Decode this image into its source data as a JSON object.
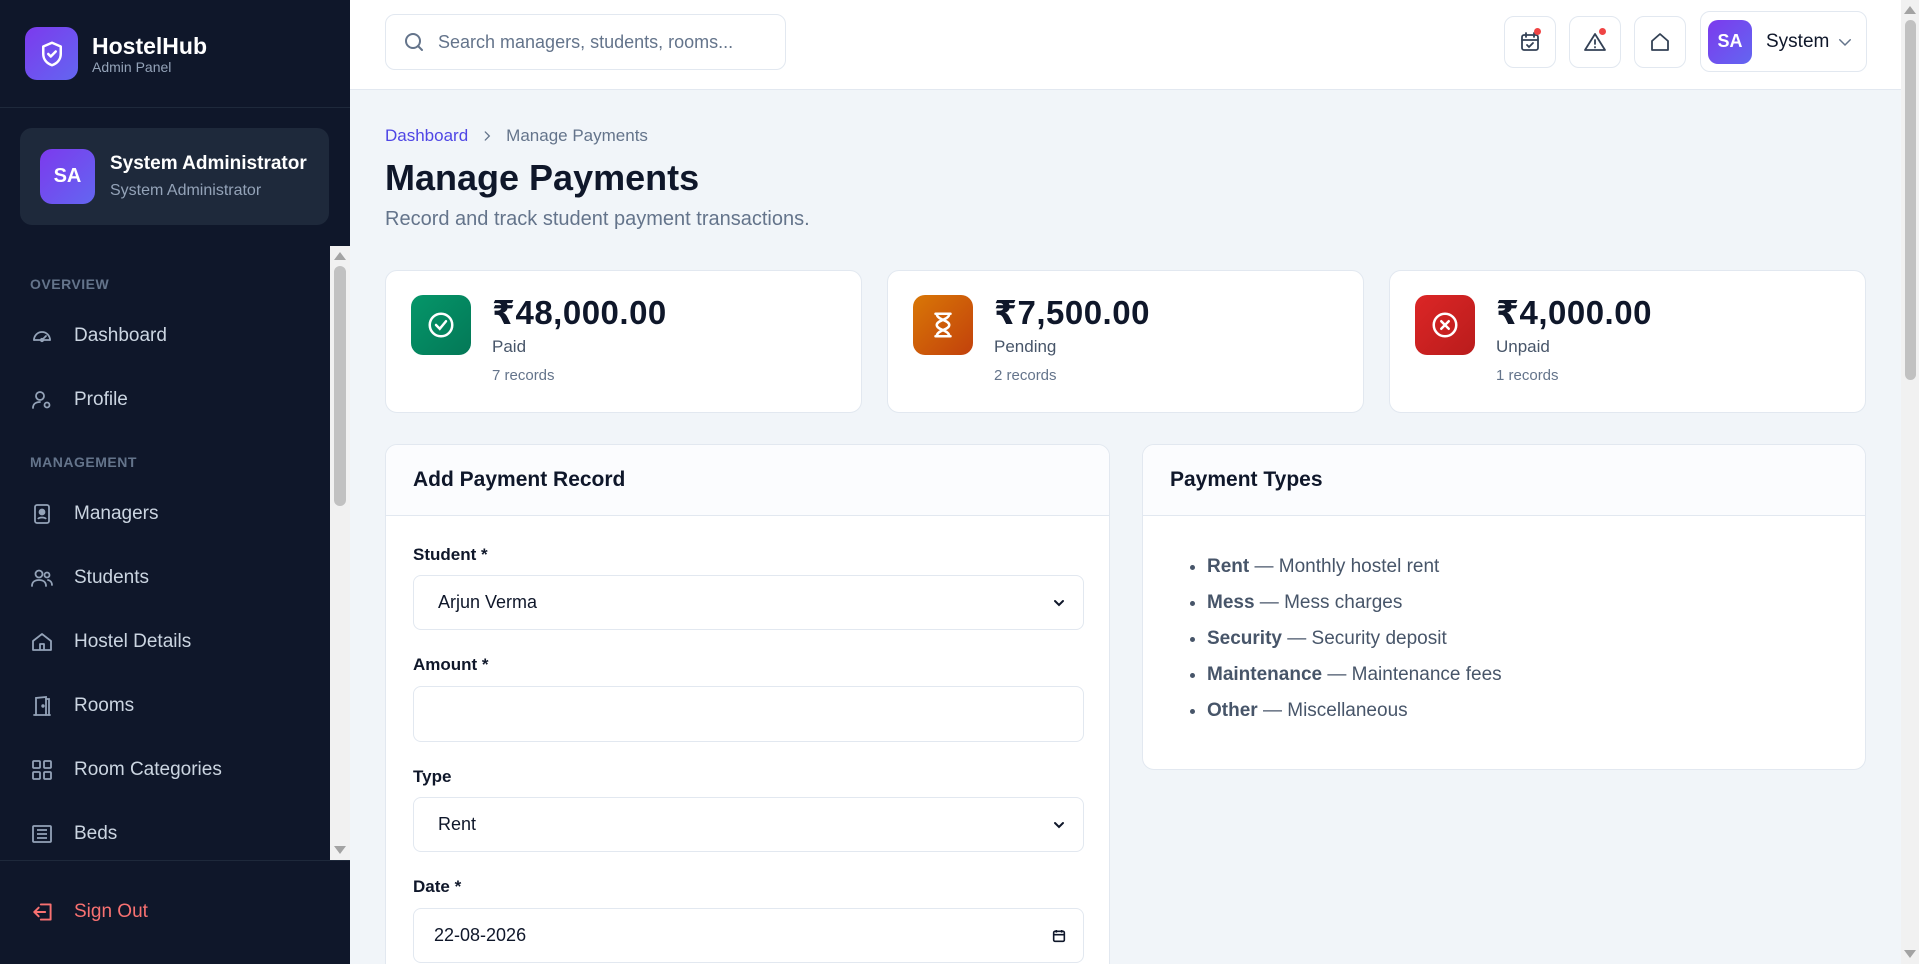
{
  "brand": {
    "name": "HostelHub",
    "subtitle": "Admin Panel"
  },
  "user": {
    "initials": "SA",
    "name": "System Administrator",
    "role": "System Administrator",
    "short_name": "System"
  },
  "sidebar": {
    "sections": [
      {
        "title": "OVERVIEW",
        "items": [
          {
            "label": "Dashboard",
            "icon": "gauge-icon"
          },
          {
            "label": "Profile",
            "icon": "user-gear-icon"
          }
        ]
      },
      {
        "title": "MANAGEMENT",
        "items": [
          {
            "label": "Managers",
            "icon": "id-badge-icon"
          },
          {
            "label": "Students",
            "icon": "users-icon"
          },
          {
            "label": "Hostel Details",
            "icon": "home-icon"
          },
          {
            "label": "Rooms",
            "icon": "door-icon"
          },
          {
            "label": "Room Categories",
            "icon": "grid-icon"
          },
          {
            "label": "Beds",
            "icon": "bed-icon"
          }
        ]
      }
    ],
    "sign_out": "Sign Out"
  },
  "header": {
    "search_placeholder": "Search managers, students, rooms..."
  },
  "breadcrumb": {
    "root": "Dashboard",
    "current": "Manage Payments"
  },
  "page": {
    "title": "Manage Payments",
    "subtitle": "Record and track student payment transactions."
  },
  "stats": [
    {
      "value": "₹48,000.00",
      "label": "Paid",
      "count": "7 records",
      "color": "#059669"
    },
    {
      "value": "₹7,500.00",
      "label": "Pending",
      "count": "2 records",
      "color": "#d97706"
    },
    {
      "value": "₹4,000.00",
      "label": "Unpaid",
      "count": "1 records",
      "color": "#dc2626"
    }
  ],
  "form": {
    "title": "Add Payment Record",
    "student_label": "Student *",
    "student_value": "Arjun Verma",
    "amount_label": "Amount *",
    "amount_value": "",
    "type_label": "Type",
    "type_value": "Rent",
    "date_label": "Date *",
    "date_value": "22-08-2026"
  },
  "payment_types": {
    "title": "Payment Types",
    "items": [
      {
        "name": "Rent",
        "desc": " — Monthly hostel rent"
      },
      {
        "name": "Mess",
        "desc": " — Mess charges"
      },
      {
        "name": "Security",
        "desc": " — Security deposit"
      },
      {
        "name": "Maintenance",
        "desc": " — Maintenance fees"
      },
      {
        "name": "Other",
        "desc": " — Miscellaneous"
      }
    ]
  }
}
